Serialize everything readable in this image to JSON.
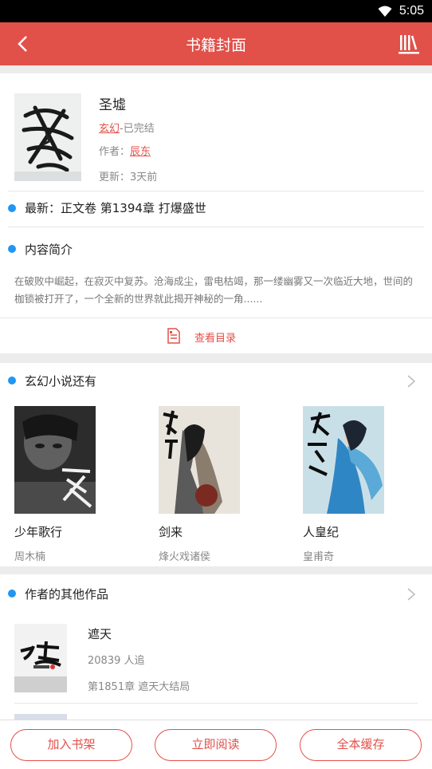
{
  "status_bar": {
    "time": "5:05",
    "wifi_icon": "wifi-icon"
  },
  "app_bar": {
    "title": "书籍封面",
    "back_icon": "back-arrow-icon",
    "shelf_icon": "bookshelf-icon"
  },
  "book": {
    "title": "圣墟",
    "category": "玄幻",
    "status": "-已完结",
    "author_label": "作者：",
    "author": "辰东",
    "update": "更新：3天前"
  },
  "latest": "最新：正文卷 第1394章 打爆盛世",
  "intro": {
    "heading": "内容简介",
    "text": "在破败中崛起，在寂灭中复苏。沧海成尘，雷电枯竭，那一缕幽雾又一次临近大地，世间的枷锁被打开了，一个全新的世界就此揭开神秘的一角......"
  },
  "toc_label": "查看目录",
  "recommend": {
    "heading": "玄幻小说还有",
    "books": [
      {
        "name": "少年歌行",
        "author": "周木楠"
      },
      {
        "name": "剑来",
        "author": "烽火戏诸侯"
      },
      {
        "name": "人皇纪",
        "author": "皇甫奇"
      }
    ]
  },
  "author_works": {
    "heading": "作者的其他作品",
    "items": [
      {
        "title": "遮天",
        "fans": "20839 人追",
        "latest": "第1851章  遮天大结局"
      }
    ]
  },
  "actions": {
    "add_shelf": "加入书架",
    "read_now": "立即阅读",
    "cache_all": "全本缓存"
  },
  "colors": {
    "accent": "#e2504a",
    "dot": "#2196f3"
  }
}
